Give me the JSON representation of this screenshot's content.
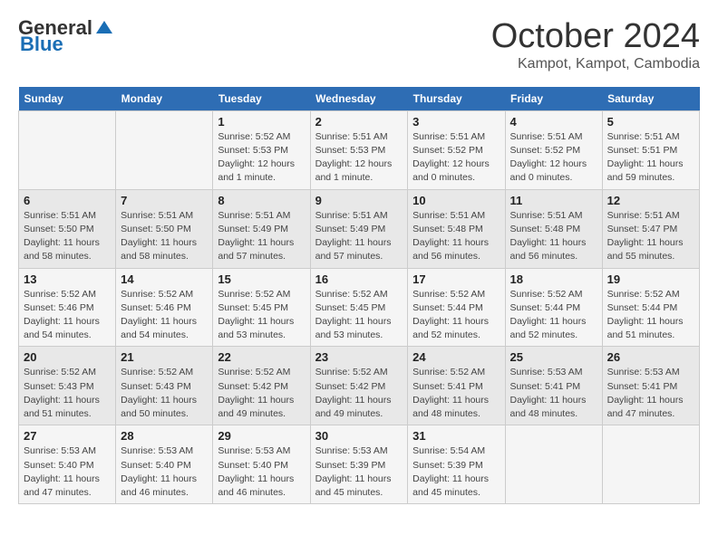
{
  "header": {
    "logo_general": "General",
    "logo_blue": "Blue",
    "month_title": "October 2024",
    "location": "Kampot, Kampot, Cambodia"
  },
  "columns": [
    "Sunday",
    "Monday",
    "Tuesday",
    "Wednesday",
    "Thursday",
    "Friday",
    "Saturday"
  ],
  "weeks": [
    [
      {
        "day": "",
        "info": ""
      },
      {
        "day": "",
        "info": ""
      },
      {
        "day": "1",
        "info": "Sunrise: 5:52 AM\nSunset: 5:53 PM\nDaylight: 12 hours\nand 1 minute."
      },
      {
        "day": "2",
        "info": "Sunrise: 5:51 AM\nSunset: 5:53 PM\nDaylight: 12 hours\nand 1 minute."
      },
      {
        "day": "3",
        "info": "Sunrise: 5:51 AM\nSunset: 5:52 PM\nDaylight: 12 hours\nand 0 minutes."
      },
      {
        "day": "4",
        "info": "Sunrise: 5:51 AM\nSunset: 5:52 PM\nDaylight: 12 hours\nand 0 minutes."
      },
      {
        "day": "5",
        "info": "Sunrise: 5:51 AM\nSunset: 5:51 PM\nDaylight: 11 hours\nand 59 minutes."
      }
    ],
    [
      {
        "day": "6",
        "info": "Sunrise: 5:51 AM\nSunset: 5:50 PM\nDaylight: 11 hours\nand 58 minutes."
      },
      {
        "day": "7",
        "info": "Sunrise: 5:51 AM\nSunset: 5:50 PM\nDaylight: 11 hours\nand 58 minutes."
      },
      {
        "day": "8",
        "info": "Sunrise: 5:51 AM\nSunset: 5:49 PM\nDaylight: 11 hours\nand 57 minutes."
      },
      {
        "day": "9",
        "info": "Sunrise: 5:51 AM\nSunset: 5:49 PM\nDaylight: 11 hours\nand 57 minutes."
      },
      {
        "day": "10",
        "info": "Sunrise: 5:51 AM\nSunset: 5:48 PM\nDaylight: 11 hours\nand 56 minutes."
      },
      {
        "day": "11",
        "info": "Sunrise: 5:51 AM\nSunset: 5:48 PM\nDaylight: 11 hours\nand 56 minutes."
      },
      {
        "day": "12",
        "info": "Sunrise: 5:51 AM\nSunset: 5:47 PM\nDaylight: 11 hours\nand 55 minutes."
      }
    ],
    [
      {
        "day": "13",
        "info": "Sunrise: 5:52 AM\nSunset: 5:46 PM\nDaylight: 11 hours\nand 54 minutes."
      },
      {
        "day": "14",
        "info": "Sunrise: 5:52 AM\nSunset: 5:46 PM\nDaylight: 11 hours\nand 54 minutes."
      },
      {
        "day": "15",
        "info": "Sunrise: 5:52 AM\nSunset: 5:45 PM\nDaylight: 11 hours\nand 53 minutes."
      },
      {
        "day": "16",
        "info": "Sunrise: 5:52 AM\nSunset: 5:45 PM\nDaylight: 11 hours\nand 53 minutes."
      },
      {
        "day": "17",
        "info": "Sunrise: 5:52 AM\nSunset: 5:44 PM\nDaylight: 11 hours\nand 52 minutes."
      },
      {
        "day": "18",
        "info": "Sunrise: 5:52 AM\nSunset: 5:44 PM\nDaylight: 11 hours\nand 52 minutes."
      },
      {
        "day": "19",
        "info": "Sunrise: 5:52 AM\nSunset: 5:44 PM\nDaylight: 11 hours\nand 51 minutes."
      }
    ],
    [
      {
        "day": "20",
        "info": "Sunrise: 5:52 AM\nSunset: 5:43 PM\nDaylight: 11 hours\nand 51 minutes."
      },
      {
        "day": "21",
        "info": "Sunrise: 5:52 AM\nSunset: 5:43 PM\nDaylight: 11 hours\nand 50 minutes."
      },
      {
        "day": "22",
        "info": "Sunrise: 5:52 AM\nSunset: 5:42 PM\nDaylight: 11 hours\nand 49 minutes."
      },
      {
        "day": "23",
        "info": "Sunrise: 5:52 AM\nSunset: 5:42 PM\nDaylight: 11 hours\nand 49 minutes."
      },
      {
        "day": "24",
        "info": "Sunrise: 5:52 AM\nSunset: 5:41 PM\nDaylight: 11 hours\nand 48 minutes."
      },
      {
        "day": "25",
        "info": "Sunrise: 5:53 AM\nSunset: 5:41 PM\nDaylight: 11 hours\nand 48 minutes."
      },
      {
        "day": "26",
        "info": "Sunrise: 5:53 AM\nSunset: 5:41 PM\nDaylight: 11 hours\nand 47 minutes."
      }
    ],
    [
      {
        "day": "27",
        "info": "Sunrise: 5:53 AM\nSunset: 5:40 PM\nDaylight: 11 hours\nand 47 minutes."
      },
      {
        "day": "28",
        "info": "Sunrise: 5:53 AM\nSunset: 5:40 PM\nDaylight: 11 hours\nand 46 minutes."
      },
      {
        "day": "29",
        "info": "Sunrise: 5:53 AM\nSunset: 5:40 PM\nDaylight: 11 hours\nand 46 minutes."
      },
      {
        "day": "30",
        "info": "Sunrise: 5:53 AM\nSunset: 5:39 PM\nDaylight: 11 hours\nand 45 minutes."
      },
      {
        "day": "31",
        "info": "Sunrise: 5:54 AM\nSunset: 5:39 PM\nDaylight: 11 hours\nand 45 minutes."
      },
      {
        "day": "",
        "info": ""
      },
      {
        "day": "",
        "info": ""
      }
    ]
  ]
}
